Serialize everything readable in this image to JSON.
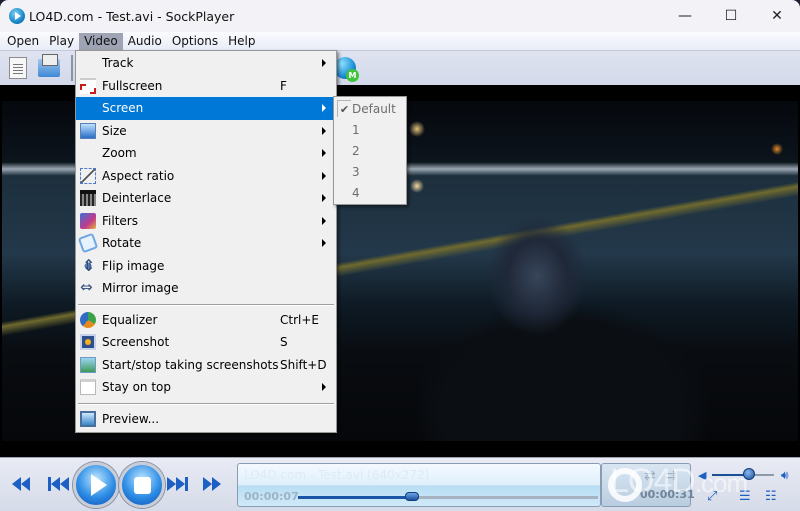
{
  "window": {
    "title": "LO4D.com - Test.avi - SockPlayer",
    "controls": {
      "minimize": "—",
      "maximize": "☐",
      "close": "✕"
    }
  },
  "menubar": {
    "items": [
      {
        "label": "Open"
      },
      {
        "label": "Play"
      },
      {
        "label": "Video",
        "active": true
      },
      {
        "label": "Audio"
      },
      {
        "label": "Options"
      },
      {
        "label": "Help"
      }
    ]
  },
  "toolbar": {
    "buttons": [
      {
        "icon": "document-icon",
        "name": "open-file"
      },
      {
        "icon": "clapperboard-folder-icon",
        "name": "open-media"
      },
      {
        "icon": "globe-messenger-icon",
        "name": "online"
      }
    ]
  },
  "video_menu": {
    "items": [
      {
        "label": "Track",
        "icon": "",
        "shortcut": "",
        "submenu": true
      },
      {
        "label": "Fullscreen",
        "icon": "fullscreen-icon",
        "shortcut": "F",
        "submenu": false
      },
      {
        "label": "Screen",
        "icon": "",
        "shortcut": "",
        "submenu": true,
        "highlighted": true
      },
      {
        "label": "Size",
        "icon": "size-icon",
        "shortcut": "",
        "submenu": true
      },
      {
        "label": "Zoom",
        "icon": "",
        "shortcut": "",
        "submenu": true
      },
      {
        "label": "Aspect ratio",
        "icon": "aspect-ratio-icon",
        "shortcut": "",
        "submenu": true
      },
      {
        "label": "Deinterlace",
        "icon": "deinterlace-icon",
        "shortcut": "",
        "submenu": true
      },
      {
        "label": "Filters",
        "icon": "filters-icon",
        "shortcut": "",
        "submenu": true
      },
      {
        "label": "Rotate",
        "icon": "rotate-icon",
        "shortcut": "",
        "submenu": true
      },
      {
        "label": "Flip image",
        "icon": "flip-icon",
        "shortcut": "",
        "submenu": false
      },
      {
        "label": "Mirror image",
        "icon": "mirror-icon",
        "shortcut": "",
        "submenu": false
      },
      {
        "label": "Equalizer",
        "icon": "equalizer-icon",
        "shortcut": "Ctrl+E",
        "submenu": false
      },
      {
        "label": "Screenshot",
        "icon": "screenshot-icon",
        "shortcut": "S",
        "submenu": false
      },
      {
        "label": "Start/stop taking screenshots",
        "icon": "screenshots-icon",
        "shortcut": "Shift+D",
        "submenu": false
      },
      {
        "label": "Stay on top",
        "icon": "stay-on-top-icon",
        "shortcut": "",
        "submenu": true
      },
      {
        "label": "Preview...",
        "icon": "preview-icon",
        "shortcut": "",
        "submenu": false
      }
    ]
  },
  "screen_submenu": {
    "items": [
      {
        "label": "Default",
        "checked": true
      },
      {
        "label": "1"
      },
      {
        "label": "2"
      },
      {
        "label": "3"
      },
      {
        "label": "4"
      }
    ]
  },
  "player": {
    "info_title": "LO4D.com - Test.avi (640x272)",
    "current_time": "00:00:07",
    "total_time": "00:00:31",
    "seek_progress": 0.38,
    "volume": 0.6,
    "accent_color": "#1d5fc2",
    "highlight_color": "#0078d7"
  },
  "watermark": {
    "brand": "LO4D",
    "suffix": ".com"
  }
}
